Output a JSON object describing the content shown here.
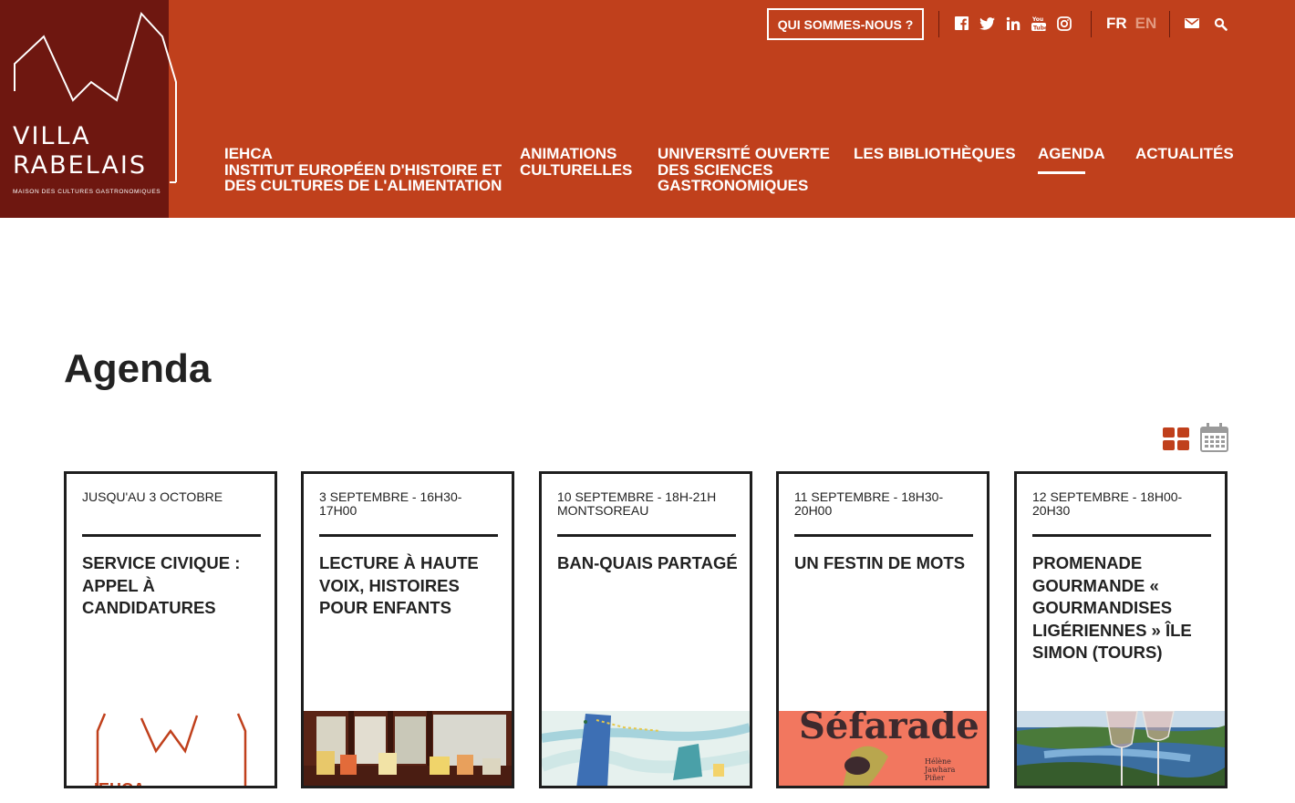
{
  "brand": {
    "line1": "VILLA",
    "line2": "RABELAIS",
    "tagline": "MAISON DES CULTURES GASTRONOMIQUES"
  },
  "header": {
    "who_label": "QUI SOMMES-NOUS ?",
    "social_icons": [
      "facebook-icon",
      "twitter-icon",
      "linkedin-icon",
      "youtube-icon",
      "instagram-icon"
    ],
    "lang_fr": "FR",
    "lang_en": "EN",
    "accent": "#c0401c",
    "logo_bg": "#6e1710"
  },
  "nav": {
    "iehca": [
      "IEHCA",
      "INSTITUT EUROPÉEN D'HISTOIRE ET",
      "DES CULTURES DE L'ALIMENTATION"
    ],
    "animations": [
      "ANIMATIONS",
      "CULTURELLES"
    ],
    "universite": [
      "UNIVERSITÉ OUVERTE",
      "DES SCIENCES",
      "GASTRONOMIQUES"
    ],
    "bibliotheques": "LES BIBLIOTHÈQUES",
    "agenda": "AGENDA",
    "actualites": "ACTUALITÉS",
    "active": "AGENDA"
  },
  "main": {
    "title": "Agenda"
  },
  "cards": [
    {
      "date": "JUSQU'AU 3 OCTOBRE",
      "title": "SERVICE CIVIQUE : APPEL À CANDIDATURES",
      "thumb_text": "IEHCA"
    },
    {
      "date": "3 SEPTEMBRE - 16H30-17H00",
      "title": "LECTURE À HAUTE VOIX, HISTOIRES POUR ENFANTS"
    },
    {
      "date": "10 SEPTEMBRE - 18H-21H MONTSOREAU",
      "title": "BAN-QUAIS PARTAGÉ"
    },
    {
      "date": "11 SEPTEMBRE - 18H30-20H00",
      "title": "UN FESTIN DE MOTS",
      "thumb_title": "Séfarade",
      "thumb_author": [
        "Hélène",
        "Jawhara",
        "Piñer"
      ]
    },
    {
      "date": "12 SEPTEMBRE - 18H00-20H30",
      "title": "PROMENADE GOURMANDE « GOURMANDISES LIGÉRIENNES » ÎLE SIMON (TOURS)"
    }
  ]
}
